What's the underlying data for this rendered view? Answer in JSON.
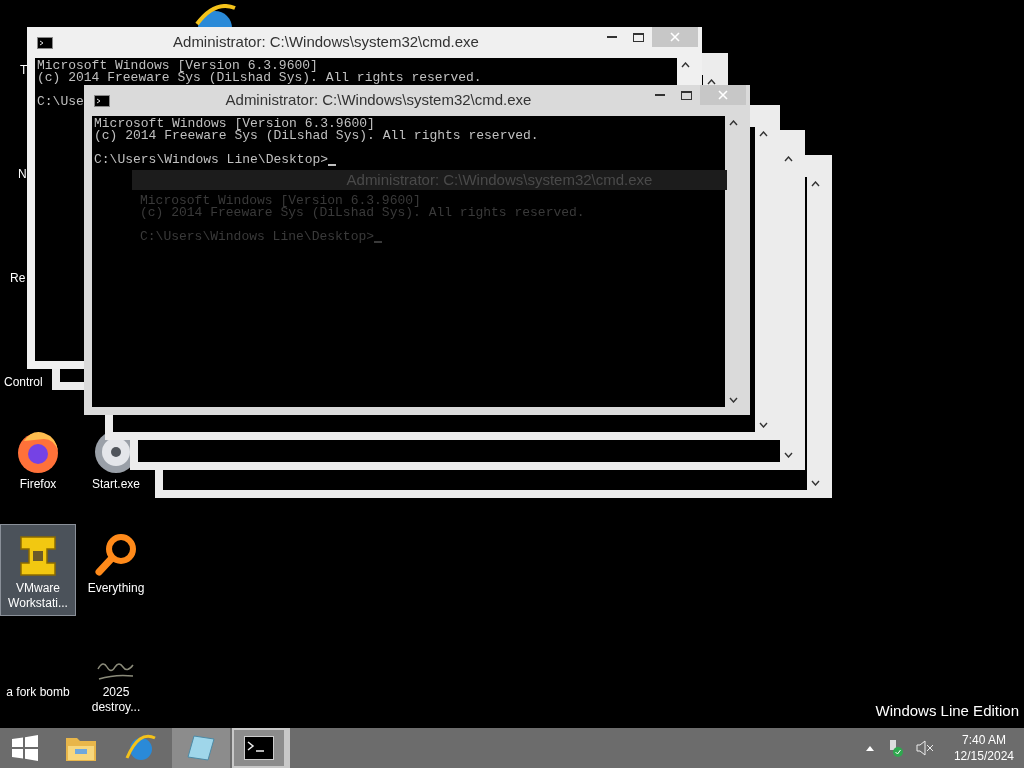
{
  "desktop_icons": [
    {
      "label": "T",
      "kind": "hidden",
      "selected": false
    },
    {
      "label": "N",
      "kind": "hidden",
      "selected": false
    },
    {
      "label": "Re",
      "kind": "hidden",
      "selected": false
    },
    {
      "label": "Control",
      "kind": "hidden",
      "selected": false
    },
    {
      "label": "Firefox",
      "kind": "firefox",
      "selected": false
    },
    {
      "label": "Start.exe",
      "kind": "disc",
      "selected": false
    },
    {
      "label": "VMware Workstati...",
      "kind": "vmware",
      "selected": true
    },
    {
      "label": "Everything",
      "kind": "magnifier",
      "selected": false
    },
    {
      "label": "a fork bomb",
      "kind": "blank",
      "selected": false
    },
    {
      "label": "2025 destroy...",
      "kind": "scribble",
      "selected": false
    },
    {
      "kind": "globe",
      "selected": false
    }
  ],
  "windows": [
    {
      "kind": "frame"
    },
    {
      "kind": "frame"
    },
    {
      "kind": "frame"
    },
    {
      "kind": "frame"
    },
    {
      "kind": "console",
      "title": "Administrator: C:\\Windows\\system32\\cmd.exe",
      "paragraphs": [
        [
          "Microsoft Windows [Version 6.3.9600]",
          "(c) 2014 Freeware Sys (DiLshad Sys). All rights reserved."
        ],
        [
          "C:\\Use"
        ]
      ]
    },
    {
      "kind": "console",
      "title": "Administrator: C:\\Windows\\system32\\cmd.exe",
      "paragraphs": [
        [
          "Microsoft Windows [Version 6.3.9600]",
          "(c) 2014 Freeware Sys (DiLshad Sys). All rights reserved."
        ],
        [
          "C:\\Users\\Windows Line\\Desktop>"
        ]
      ],
      "cursor": true
    },
    {
      "kind": "ghost",
      "title": "Administrator: C:\\Windows\\system32\\cmd.exe",
      "paragraphs": [
        [
          "Microsoft Windows [Version 6.3.9600]",
          "(c) 2014 Freeware Sys (DiLshad Sys). All rights reserved."
        ],
        [
          "C:\\Users\\Windows Line\\Desktop>"
        ]
      ],
      "cursor": true
    }
  ],
  "edition_text": "Windows Line Edition",
  "taskbar": {
    "buttons": [
      {
        "kind": "start",
        "running": false,
        "selected": false
      },
      {
        "kind": "folder",
        "running": false,
        "selected": false
      },
      {
        "kind": "globe",
        "running": false,
        "selected": false
      },
      {
        "kind": "notepad",
        "running": true,
        "selected": false
      },
      {
        "kind": "console",
        "running": true,
        "selected": true
      }
    ],
    "tray": {
      "time": "7:40 AM",
      "date": "12/15/2024",
      "muted": true
    }
  }
}
